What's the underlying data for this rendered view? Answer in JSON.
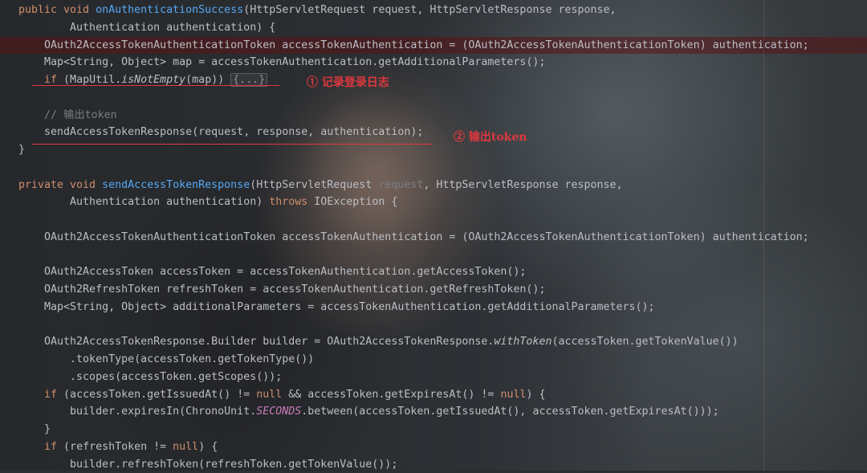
{
  "editor": {
    "lines": [
      {
        "tokens": [
          {
            "t": "public void ",
            "c": "kw"
          },
          {
            "t": "onAuthenticationSuccess",
            "c": "fn"
          },
          {
            "t": "(HttpServletRequest request, HttpServletResponse response,",
            "c": ""
          }
        ]
      },
      {
        "tokens": [
          {
            "t": "        Authentication authentication) {",
            "c": ""
          }
        ]
      },
      {
        "tokens": [
          {
            "t": "    OAuth2AccessTokenAuthenticationToken accessTokenAuthentication = (OAuth2AccessTokenAuthenticationToken) authentication;",
            "c": ""
          }
        ]
      },
      {
        "tokens": [
          {
            "t": "    Map<String, Object> map = accessTokenAuthentication.getAdditionalParameters();",
            "c": ""
          }
        ]
      },
      {
        "tokens": [
          {
            "t": "    ",
            "c": ""
          },
          {
            "t": "if",
            "c": "kw"
          },
          {
            "t": " (MapUtil.",
            "c": ""
          },
          {
            "t": "isNotEmpty",
            "c": "it"
          },
          {
            "t": "(map)) ",
            "c": ""
          },
          {
            "t": "{...}",
            "c": "fold"
          }
        ]
      },
      {
        "tokens": [
          {
            "t": "",
            "c": ""
          }
        ]
      },
      {
        "tokens": [
          {
            "t": "    // 输出token",
            "c": "cm"
          }
        ]
      },
      {
        "tokens": [
          {
            "t": "    sendAccessTokenResponse(request, response, authentication);",
            "c": ""
          }
        ]
      },
      {
        "tokens": [
          {
            "t": "}",
            "c": ""
          }
        ]
      },
      {
        "tokens": [
          {
            "t": "",
            "c": ""
          }
        ]
      },
      {
        "tokens": [
          {
            "t": "private void ",
            "c": "kw"
          },
          {
            "t": "sendAccessTokenResponse",
            "c": "fn"
          },
          {
            "t": "(HttpServletRequest ",
            "c": ""
          },
          {
            "t": "request",
            "c": "gray"
          },
          {
            "t": ", HttpServletResponse response,",
            "c": ""
          }
        ]
      },
      {
        "tokens": [
          {
            "t": "        Authentication authentication) ",
            "c": ""
          },
          {
            "t": "throws",
            "c": "kw"
          },
          {
            "t": " IOException {",
            "c": ""
          }
        ]
      },
      {
        "tokens": [
          {
            "t": "",
            "c": ""
          }
        ]
      },
      {
        "tokens": [
          {
            "t": "    OAuth2AccessTokenAuthenticationToken accessTokenAuthentication = (OAuth2AccessTokenAuthenticationToken) authentication;",
            "c": ""
          }
        ]
      },
      {
        "tokens": [
          {
            "t": "",
            "c": ""
          }
        ]
      },
      {
        "tokens": [
          {
            "t": "    OAuth2AccessToken accessToken = accessTokenAuthentication.getAccessToken();",
            "c": ""
          }
        ]
      },
      {
        "tokens": [
          {
            "t": "    OAuth2RefreshToken refreshToken = accessTokenAuthentication.getRefreshToken();",
            "c": ""
          }
        ]
      },
      {
        "tokens": [
          {
            "t": "    Map<String, Object> additionalParameters = accessTokenAuthentication.getAdditionalParameters();",
            "c": ""
          }
        ]
      },
      {
        "tokens": [
          {
            "t": "",
            "c": ""
          }
        ]
      },
      {
        "tokens": [
          {
            "t": "    OAuth2AccessTokenResponse.Builder builder = OAuth2AccessTokenResponse.",
            "c": ""
          },
          {
            "t": "withToken",
            "c": "it"
          },
          {
            "t": "(accessToken.getTokenValue())",
            "c": ""
          }
        ]
      },
      {
        "tokens": [
          {
            "t": "        .tokenType(accessToken.getTokenType())",
            "c": ""
          }
        ]
      },
      {
        "tokens": [
          {
            "t": "        .scopes(accessToken.getScopes());",
            "c": ""
          }
        ]
      },
      {
        "tokens": [
          {
            "t": "    ",
            "c": ""
          },
          {
            "t": "if",
            "c": "kw"
          },
          {
            "t": " (accessToken.getIssuedAt() != ",
            "c": ""
          },
          {
            "t": "null",
            "c": "kw"
          },
          {
            "t": " && accessToken.getExpiresAt() != ",
            "c": ""
          },
          {
            "t": "null",
            "c": "kw"
          },
          {
            "t": ") {",
            "c": ""
          }
        ]
      },
      {
        "tokens": [
          {
            "t": "        builder.expiresIn(ChronoUnit.",
            "c": ""
          },
          {
            "t": "SECONDS",
            "c": "cst"
          },
          {
            "t": ".between(accessToken.getIssuedAt(), accessToken.getExpiresAt()));",
            "c": ""
          }
        ]
      },
      {
        "tokens": [
          {
            "t": "    }",
            "c": ""
          }
        ]
      },
      {
        "tokens": [
          {
            "t": "    ",
            "c": ""
          },
          {
            "t": "if",
            "c": "kw"
          },
          {
            "t": " (refreshToken != ",
            "c": ""
          },
          {
            "t": "null",
            "c": "kw"
          },
          {
            "t": ") {",
            "c": ""
          }
        ]
      },
      {
        "tokens": [
          {
            "t": "        builder.refreshToken(refreshToken.getTokenValue());",
            "c": ""
          }
        ]
      }
    ],
    "annotations": {
      "log": "① 记录登录日志",
      "output": "② 输出token"
    }
  }
}
